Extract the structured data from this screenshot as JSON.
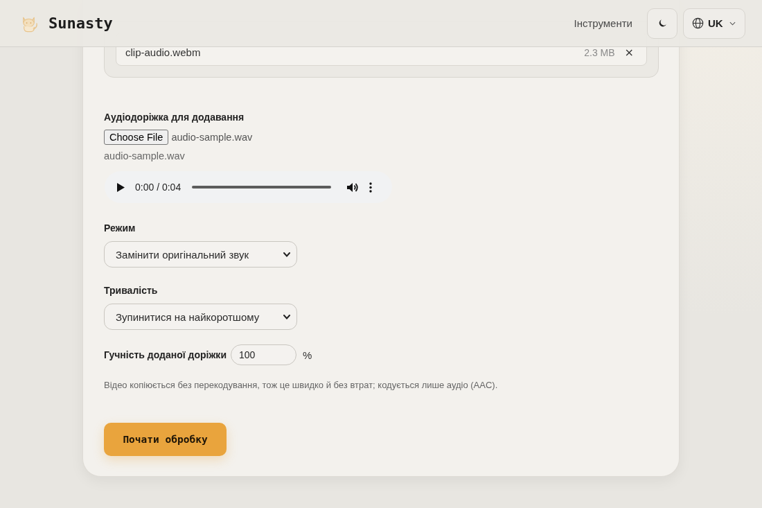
{
  "header": {
    "brand": "Sunasty",
    "nav_link": "Інструменти",
    "language": "UK"
  },
  "uploaded_file": {
    "name": "clip-audio.webm",
    "size": "2.3 MB",
    "remove": "×"
  },
  "audio_track": {
    "label": "Аудіодоріжка для додавання",
    "choose_button": "Choose File",
    "chosen_file": "audio-sample.wav",
    "file_name": "audio-sample.wav",
    "player": {
      "time": "0:00 / 0:04"
    }
  },
  "mode": {
    "label": "Режим",
    "value": "Замінити оригінальний звук"
  },
  "duration": {
    "label": "Тривалість",
    "value": "Зупинитися на найкоротшому"
  },
  "volume": {
    "label": "Гучність доданої доріжки",
    "value": "100",
    "unit": "%"
  },
  "note": "Відео копіюється без перекодування, тож це швидко й без втрат; кодується лише аудіо (AAC).",
  "start_button": "Почати обробку"
}
